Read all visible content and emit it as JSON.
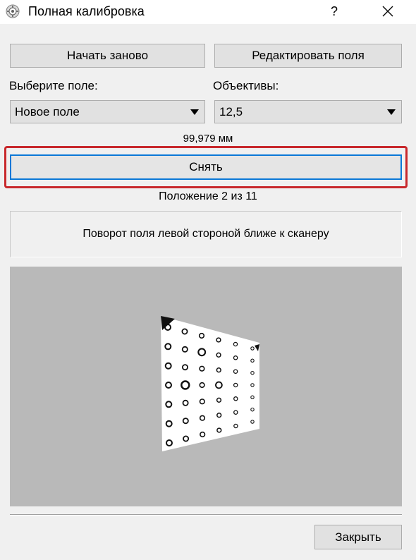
{
  "window": {
    "title": "Полная калибровка",
    "help_label": "?",
    "icon": "calibration-app-icon"
  },
  "toolbar": {
    "restart_label": "Начать заново",
    "edit_fields_label": "Редактировать поля"
  },
  "field_select": {
    "label": "Выберите поле:",
    "value": "Новое поле"
  },
  "lens_select": {
    "label": "Объективы:",
    "value": "12,5"
  },
  "distance": "99,979 мм",
  "capture_label": "Снять",
  "position_text": "Положение 2 из 11",
  "instruction_text": "Поворот поля левой стороной ближе к сканеру",
  "preview": {
    "background": "#b9b9b9",
    "description_icon": "calibration-pattern-image",
    "grid_rows": 7,
    "grid_cols": 6
  },
  "close_label": "Закрыть",
  "colors": {
    "highlight": "#c8282c",
    "focus_border": "#0a78d7"
  }
}
